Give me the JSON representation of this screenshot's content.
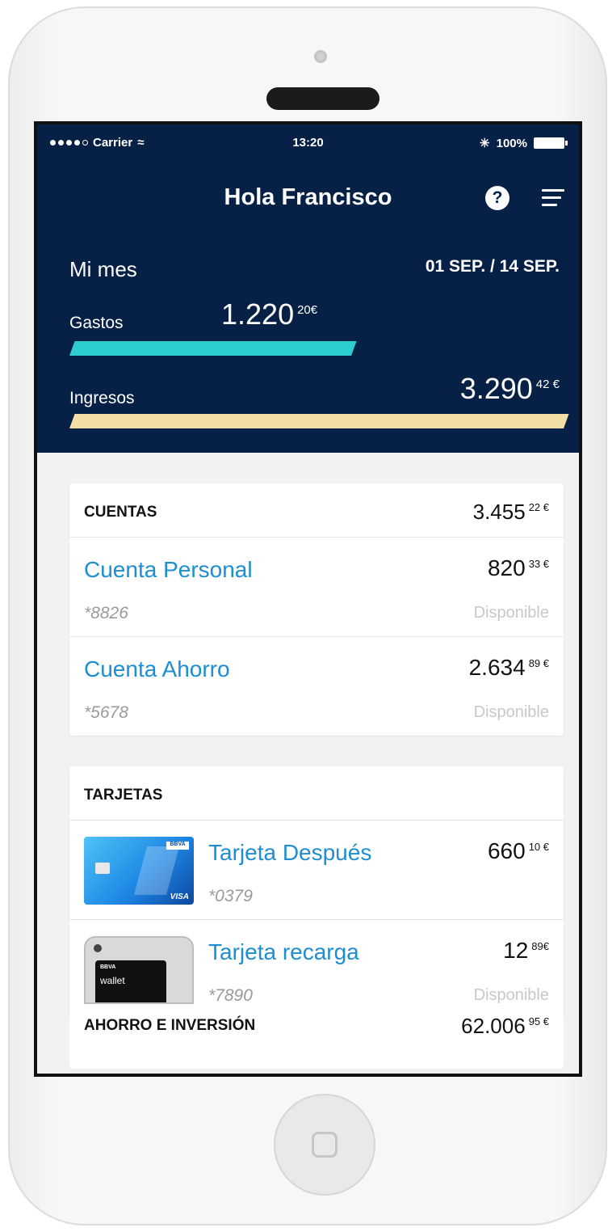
{
  "status_bar": {
    "carrier": "Carrier",
    "time": "13:20",
    "battery": "100%"
  },
  "header": {
    "title": "Hola Francisco",
    "help_icon": "question-circle-icon",
    "menu_icon": "menu-icon"
  },
  "summary": {
    "label": "Mi mes",
    "period": "01 SEP. / 14 SEP.",
    "gastos": {
      "label": "Gastos",
      "amount_int": "1.220",
      "amount_dec": "20€",
      "bar_fraction": 0.57,
      "color": "#2dcccd"
    },
    "ingresos": {
      "label": "Ingresos",
      "amount_int": "3.290",
      "amount_dec": "42 €",
      "bar_fraction": 1.0,
      "color": "#f3dfa6"
    }
  },
  "cuentas": {
    "label": "CUENTAS",
    "total_int": "3.455",
    "total_dec": "22 €",
    "items": [
      {
        "name": "Cuenta Personal",
        "number": "*8826",
        "balance_int": "820",
        "balance_dec": "33 €",
        "status": "Disponible"
      },
      {
        "name": "Cuenta Ahorro",
        "number": "*5678",
        "balance_int": "2.634",
        "balance_dec": "89 €",
        "status": "Disponible"
      }
    ]
  },
  "tarjetas": {
    "label": "TARJETAS",
    "items": [
      {
        "name": "Tarjeta Después",
        "number": "*0379",
        "balance_int": "660",
        "balance_dec": "10 €",
        "thumb_brand": "BBVA",
        "thumb_network": "VISA"
      },
      {
        "name": "Tarjeta recarga",
        "number": "*7890",
        "balance_int": "12",
        "balance_dec": "89€",
        "status": "Disponible",
        "thumb_brand": "BBVA",
        "thumb_label": "wallet"
      }
    ]
  },
  "ahorro": {
    "label": "AHORRO E INVERSIÓN",
    "total_int": "62.006",
    "total_dec": "95 €"
  },
  "colors": {
    "header_bg": "#072146",
    "link_blue": "#1d8ed1",
    "screen_bg": "#f2f2f2"
  }
}
